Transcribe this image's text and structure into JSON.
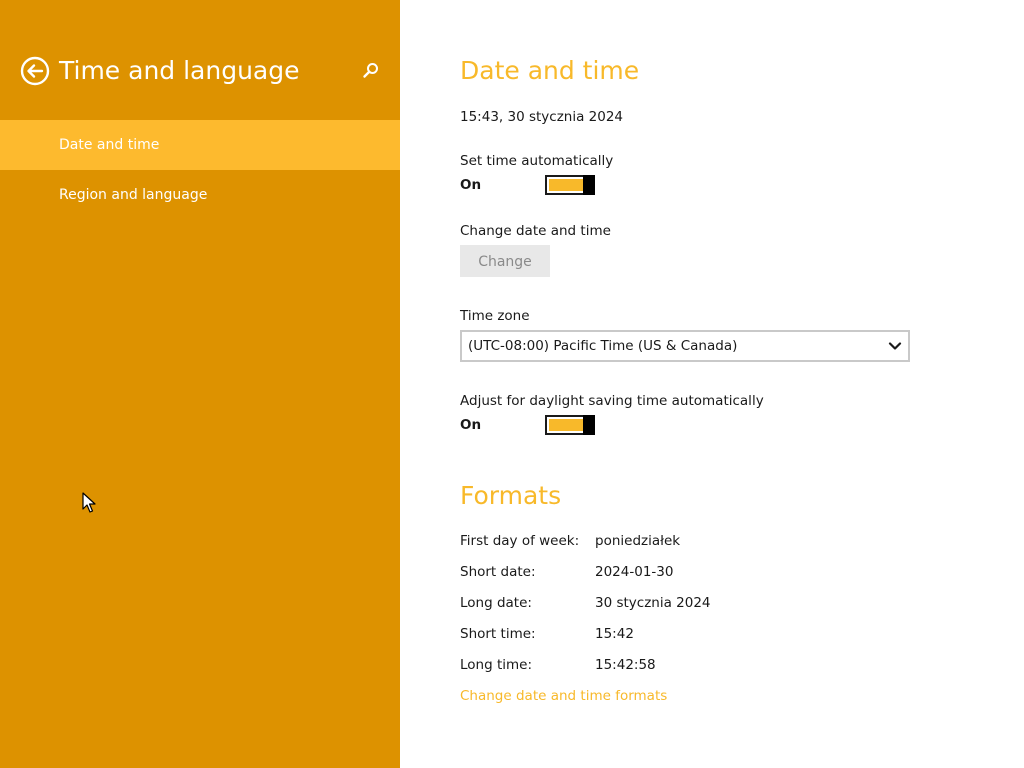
{
  "sidebar": {
    "title": "Time and language",
    "items": [
      {
        "label": "Date and time",
        "selected": true
      },
      {
        "label": "Region and language",
        "selected": false
      }
    ]
  },
  "date_time": {
    "heading": "Date and time",
    "current": "15:43, 30 stycznia 2024",
    "set_auto_label": "Set time automatically",
    "set_auto_state": "On",
    "change_label": "Change date and time",
    "change_button": "Change",
    "timezone_label": "Time zone",
    "timezone_value": "(UTC-08:00) Pacific Time (US & Canada)",
    "dst_label": "Adjust for daylight saving time automatically",
    "dst_state": "On"
  },
  "formats": {
    "heading": "Formats",
    "rows": [
      {
        "label": "First day of week:",
        "value": "poniedziałek"
      },
      {
        "label": "Short date:",
        "value": "2024-01-30"
      },
      {
        "label": "Long date:",
        "value": "30 stycznia 2024"
      },
      {
        "label": "Short time:",
        "value": "15:42"
      },
      {
        "label": "Long time:",
        "value": "15:42:58"
      }
    ],
    "link": "Change date and time formats"
  },
  "colors": {
    "sidebar_bg": "#DD9200",
    "selected_item": "#FDBA2E",
    "accent": "#F8B92A"
  },
  "icons": {
    "back": "back-arrow-icon",
    "search": "search-icon",
    "chevron": "chevron-down-icon",
    "cursor": "mouse-pointer-icon"
  }
}
